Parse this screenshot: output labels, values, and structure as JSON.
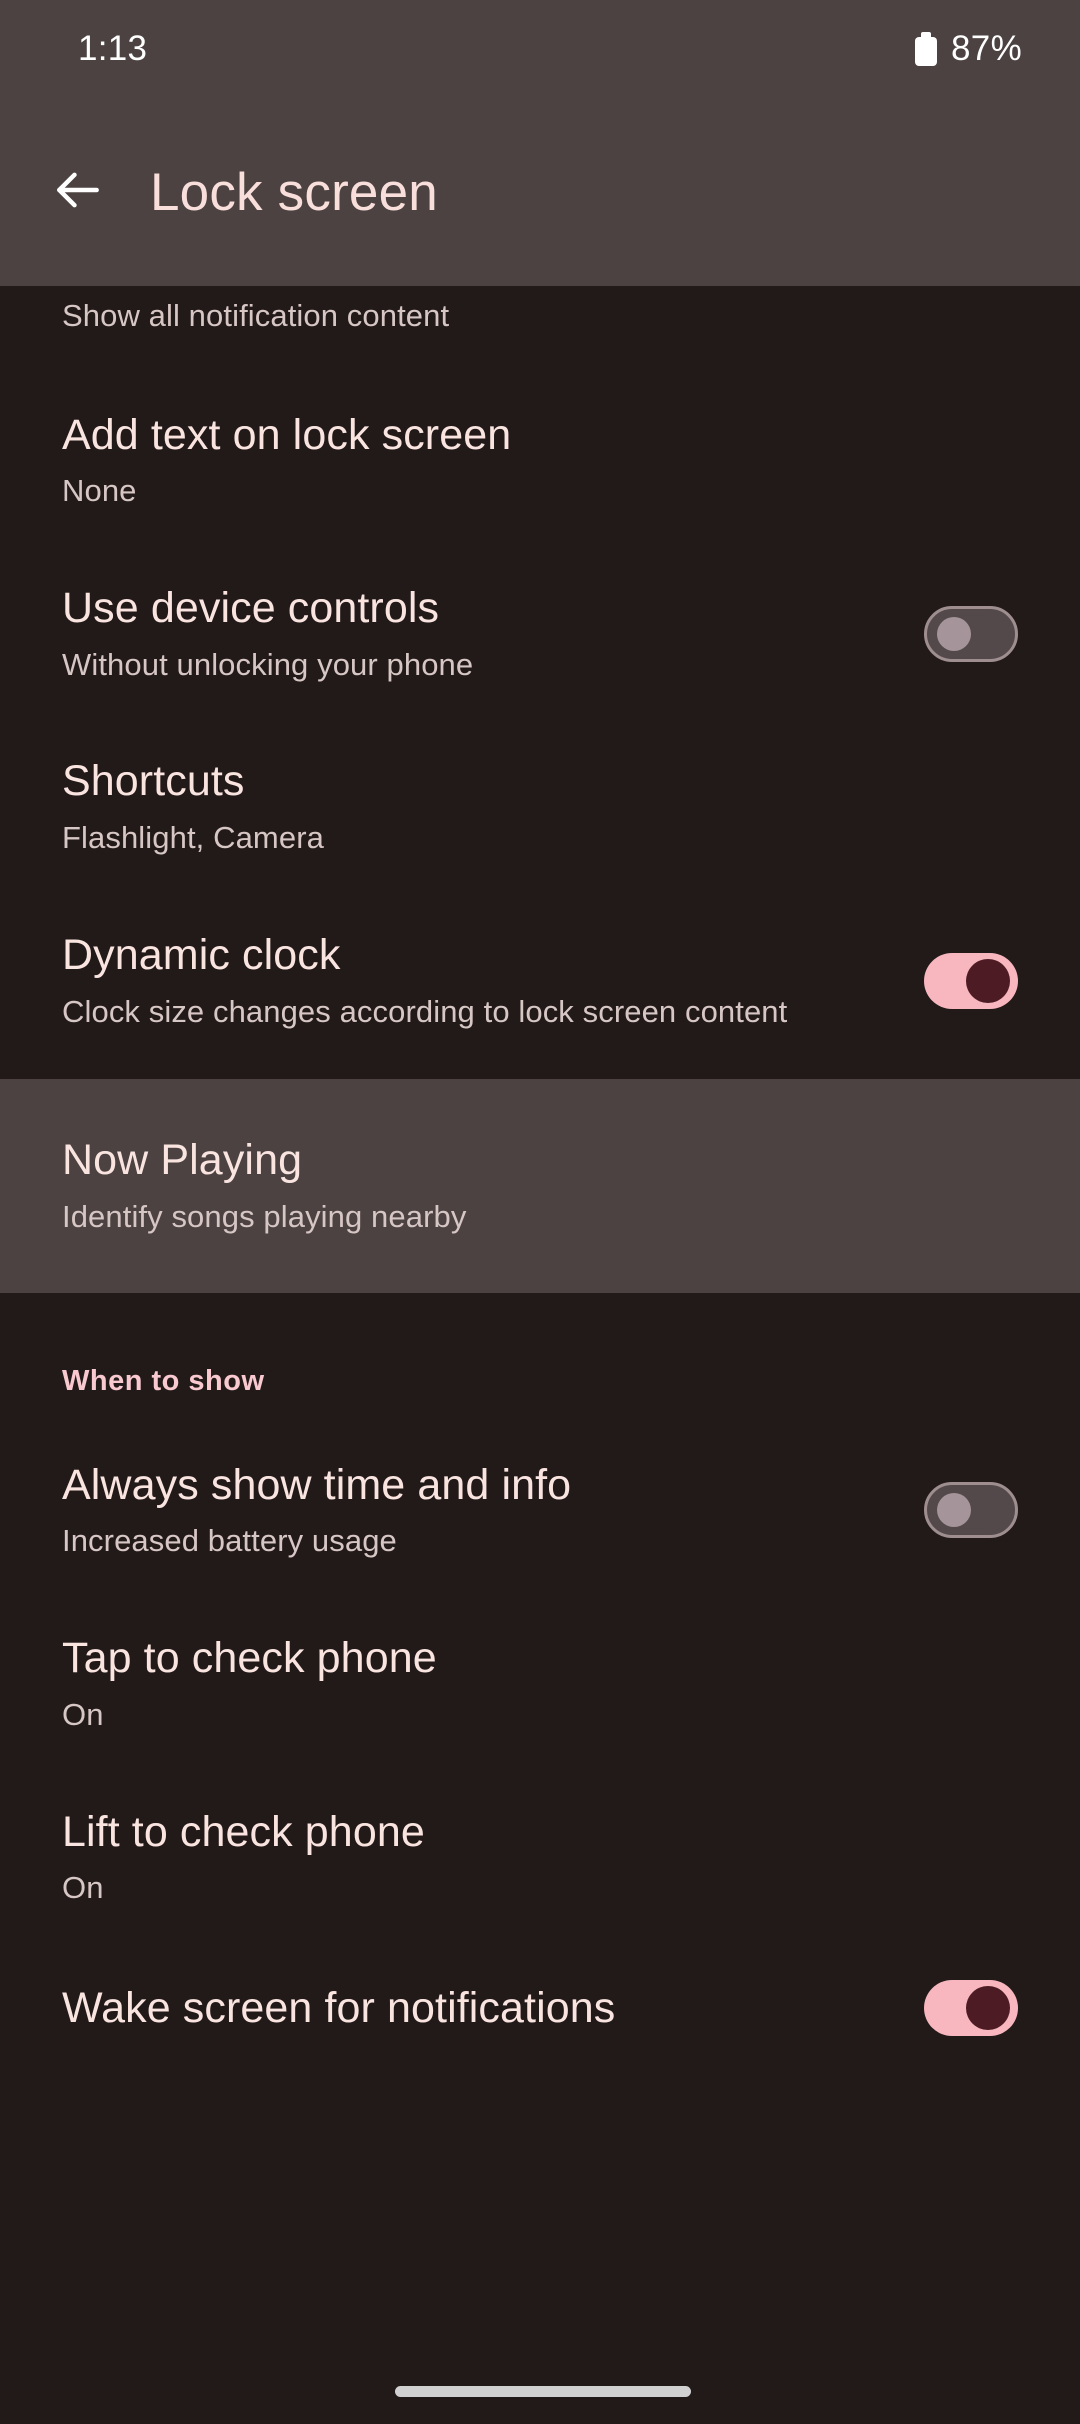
{
  "status_bar": {
    "clock": "1:13",
    "battery_percent": "87%",
    "battery_icon": "battery-icon"
  },
  "app_bar": {
    "back_icon": "back-arrow-icon",
    "title": "Lock screen"
  },
  "settings": {
    "partial_top_subtitle": "Show all notification content",
    "items": [
      {
        "title": "Add text on lock screen",
        "subtitle": "None",
        "control": "none",
        "highlighted": false
      },
      {
        "title": "Use device controls",
        "subtitle": "Without unlocking your phone",
        "control": "switch",
        "switch_state": "off",
        "highlighted": false
      },
      {
        "title": "Shortcuts",
        "subtitle": "Flashlight, Camera",
        "control": "none",
        "highlighted": false
      },
      {
        "title": "Dynamic clock",
        "subtitle": "Clock size changes according to lock screen content",
        "control": "switch",
        "switch_state": "on",
        "highlighted": false
      },
      {
        "title": "Now Playing",
        "subtitle": "Identify songs playing nearby",
        "control": "none",
        "highlighted": true
      }
    ],
    "section_header": "When to show",
    "when_to_show_items": [
      {
        "title": "Always show time and info",
        "subtitle": "Increased battery usage",
        "control": "switch",
        "switch_state": "off"
      },
      {
        "title": "Tap to check phone",
        "subtitle": "On",
        "control": "none"
      },
      {
        "title": "Lift to check phone",
        "subtitle": "On",
        "control": "none"
      },
      {
        "title": "Wake screen for notifications",
        "subtitle": "",
        "control": "switch",
        "switch_state": "on"
      }
    ]
  },
  "colors": {
    "background": "#221a19",
    "bar_background": "#4b4241",
    "title_text": "#f9e4e0",
    "subtitle_text": "#d6c6c4",
    "accent_pink": "#f8b6bf",
    "section_header_pink": "#f9c9d0",
    "app_bar_title": "#f9dfdc",
    "switch_on_thumb": "#4d1b23",
    "switch_off_track": "#53494a",
    "switch_off_border": "#9e8e8f",
    "switch_off_thumb": "#a5959a"
  }
}
